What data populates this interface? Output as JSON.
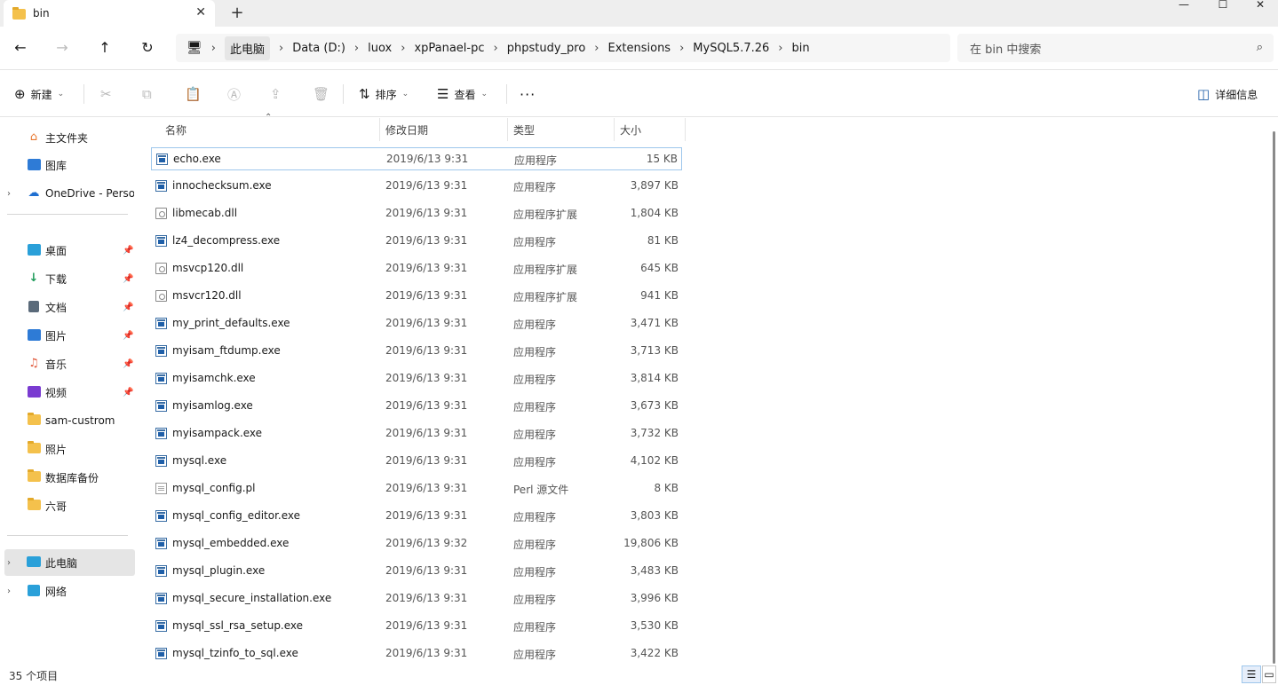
{
  "window": {
    "tab_title": "bin",
    "tab_close": "✕",
    "new_tab": "+",
    "minimize": "—",
    "maximize": "☐",
    "close": "✕"
  },
  "nav": {
    "back": "←",
    "forward": "→",
    "up": "↑",
    "refresh": "↻",
    "computer_icon": "monitor-icon",
    "breadcrumbs": [
      "此电脑",
      "Data (D:)",
      "luox",
      "xpPanael-pc",
      "phpstudy_pro",
      "Extensions",
      "MySQL5.7.26",
      "bin"
    ],
    "separator": "›"
  },
  "search": {
    "placeholder": "在 bin 中搜索"
  },
  "toolbar": {
    "new_label": "新建",
    "sort_label": "排序",
    "view_label": "查看",
    "more_label": "···",
    "details_label": "详细信息"
  },
  "sidebar": {
    "items": [
      {
        "label": "主文件夹",
        "icon": "home-icon",
        "color": "#e8772e"
      },
      {
        "label": "图库",
        "icon": "gallery-icon",
        "color": "#2e7bd6"
      },
      {
        "label": "OneDrive - Perso",
        "icon": "cloud-icon",
        "color": "#1f6fd1"
      },
      {
        "label": "桌面",
        "icon": "desktop-icon",
        "color": "#2aa0d9"
      },
      {
        "label": "下载",
        "icon": "download-icon",
        "color": "#1e9b5a"
      },
      {
        "label": "文档",
        "icon": "document-icon",
        "color": "#5a6a7a"
      },
      {
        "label": "图片",
        "icon": "picture-icon",
        "color": "#2e7bd6"
      },
      {
        "label": "音乐",
        "icon": "music-icon",
        "color": "#e0573a"
      },
      {
        "label": "视频",
        "icon": "video-icon",
        "color": "#7a3bd1"
      },
      {
        "label": "sam-custrom",
        "icon": "folder-icon",
        "color": "#f4c14c"
      },
      {
        "label": "照片",
        "icon": "folder-icon",
        "color": "#f4c14c"
      },
      {
        "label": "数据库备份",
        "icon": "folder-icon",
        "color": "#f4c14c"
      },
      {
        "label": "六哥",
        "icon": "folder-icon",
        "color": "#f4c14c"
      },
      {
        "label": "此电脑",
        "icon": "computer-icon",
        "color": "#2aa0d9"
      },
      {
        "label": "网络",
        "icon": "network-icon",
        "color": "#2aa0d9"
      }
    ]
  },
  "columns": {
    "name": "名称",
    "date": "修改日期",
    "type": "类型",
    "size": "大小"
  },
  "files": [
    {
      "name": "echo.exe",
      "date": "2019/6/13 9:31",
      "type": "应用程序",
      "size": "15 KB",
      "kind": "exe"
    },
    {
      "name": "innochecksum.exe",
      "date": "2019/6/13 9:31",
      "type": "应用程序",
      "size": "3,897 KB",
      "kind": "exe"
    },
    {
      "name": "libmecab.dll",
      "date": "2019/6/13 9:31",
      "type": "应用程序扩展",
      "size": "1,804 KB",
      "kind": "dll"
    },
    {
      "name": "lz4_decompress.exe",
      "date": "2019/6/13 9:31",
      "type": "应用程序",
      "size": "81 KB",
      "kind": "exe"
    },
    {
      "name": "msvcp120.dll",
      "date": "2019/6/13 9:31",
      "type": "应用程序扩展",
      "size": "645 KB",
      "kind": "dll"
    },
    {
      "name": "msvcr120.dll",
      "date": "2019/6/13 9:31",
      "type": "应用程序扩展",
      "size": "941 KB",
      "kind": "dll"
    },
    {
      "name": "my_print_defaults.exe",
      "date": "2019/6/13 9:31",
      "type": "应用程序",
      "size": "3,471 KB",
      "kind": "exe"
    },
    {
      "name": "myisam_ftdump.exe",
      "date": "2019/6/13 9:31",
      "type": "应用程序",
      "size": "3,713 KB",
      "kind": "exe"
    },
    {
      "name": "myisamchk.exe",
      "date": "2019/6/13 9:31",
      "type": "应用程序",
      "size": "3,814 KB",
      "kind": "exe"
    },
    {
      "name": "myisamlog.exe",
      "date": "2019/6/13 9:31",
      "type": "应用程序",
      "size": "3,673 KB",
      "kind": "exe"
    },
    {
      "name": "myisampack.exe",
      "date": "2019/6/13 9:31",
      "type": "应用程序",
      "size": "3,732 KB",
      "kind": "exe"
    },
    {
      "name": "mysql.exe",
      "date": "2019/6/13 9:31",
      "type": "应用程序",
      "size": "4,102 KB",
      "kind": "exe"
    },
    {
      "name": "mysql_config.pl",
      "date": "2019/6/13 9:31",
      "type": "Perl 源文件",
      "size": "8 KB",
      "kind": "txt"
    },
    {
      "name": "mysql_config_editor.exe",
      "date": "2019/6/13 9:31",
      "type": "应用程序",
      "size": "3,803 KB",
      "kind": "exe"
    },
    {
      "name": "mysql_embedded.exe",
      "date": "2019/6/13 9:32",
      "type": "应用程序",
      "size": "19,806 KB",
      "kind": "exe"
    },
    {
      "name": "mysql_plugin.exe",
      "date": "2019/6/13 9:31",
      "type": "应用程序",
      "size": "3,483 KB",
      "kind": "exe"
    },
    {
      "name": "mysql_secure_installation.exe",
      "date": "2019/6/13 9:31",
      "type": "应用程序",
      "size": "3,996 KB",
      "kind": "exe"
    },
    {
      "name": "mysql_ssl_rsa_setup.exe",
      "date": "2019/6/13 9:31",
      "type": "应用程序",
      "size": "3,530 KB",
      "kind": "exe"
    },
    {
      "name": "mysql_tzinfo_to_sql.exe",
      "date": "2019/6/13 9:31",
      "type": "应用程序",
      "size": "3,422 KB",
      "kind": "exe"
    }
  ],
  "status": {
    "item_count": "35 个项目"
  }
}
